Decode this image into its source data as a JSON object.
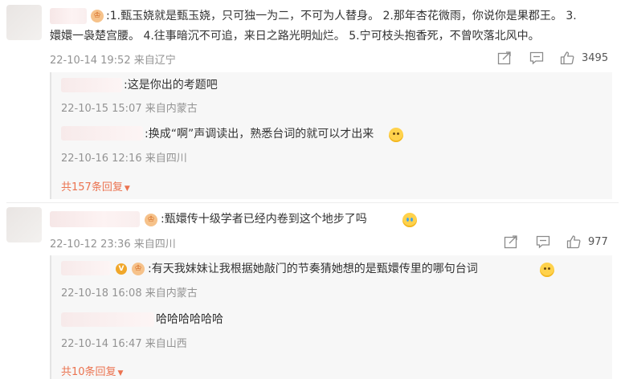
{
  "comments": [
    {
      "text": ":1.甄玉娆就是甄玉娆，只可独一为二，不可为人替身。 2.那年杏花微雨，你说你是果郡王。 3.",
      "text_line2": "嬛嬛一袅楚宫腰。 4.往事暗沉不可追，来日之路光明灿烂。 5.宁可枝头抱香死，不曾吹落北风中。",
      "meta": "22-10-14 19:52 来自辽宁",
      "likes": "3495",
      "replies": [
        {
          "text": ":这是你出的考题吧",
          "meta": "22-10-15 15:07 来自内蒙古"
        },
        {
          "text": ":换成“啊”声调读出，熟悉台词的就可以才出来",
          "meta": "22-10-16 12:16 来自四川"
        }
      ],
      "more": "共157条回复"
    },
    {
      "text": ":甄嬛传十级学者已经内卷到这个地步了吗",
      "meta": "22-10-12 23:36 来自四川",
      "likes": "977",
      "replies": [
        {
          "text": ":有天我妹妹让我根据她敲门的节奏猜她想的是甄嬛传里的哪句台词",
          "meta": "22-10-18 16:08 来自内蒙古"
        },
        {
          "text": "哈哈哈哈哈哈",
          "meta": "22-10-14 16:47 来自山西"
        }
      ],
      "more": "共10条回复"
    }
  ],
  "icons": {
    "crown": "crown-badge-icon",
    "verified": "verified-badge-icon",
    "share": "share-icon",
    "comment": "comment-icon",
    "like": "like-icon"
  },
  "colors": {
    "link": "#eb7350",
    "meta": "#939393"
  }
}
